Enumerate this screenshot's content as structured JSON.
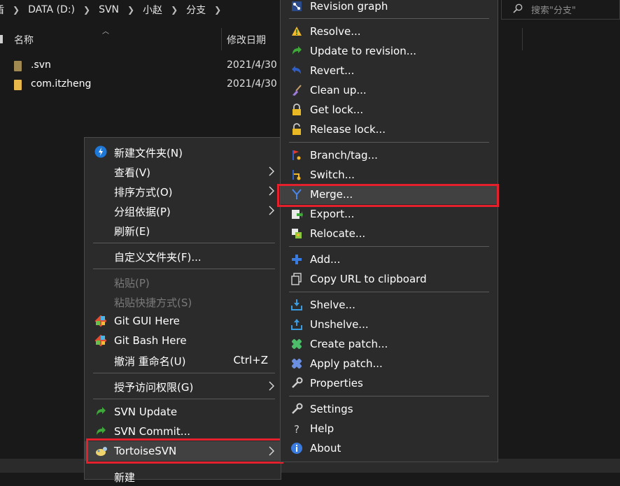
{
  "explorer": {
    "breadcrumb": [
      "盾",
      "DATA (D:)",
      "SVN",
      "小赵",
      "分支"
    ],
    "search_placeholder": "搜索\"分支\"",
    "columns": {
      "name": "名称",
      "date": "修改日期"
    },
    "files": [
      {
        "name": ".svn",
        "date": "2021/4/30"
      },
      {
        "name": "com.itzheng",
        "date": "2021/4/30"
      }
    ]
  },
  "context_menu": {
    "new_folder": "新建文件夹(N)",
    "view": "查看(V)",
    "sort_by": "排序方式(O)",
    "group_by": "分组依据(P)",
    "refresh": "刷新(E)",
    "customize_folder": "自定义文件夹(F)...",
    "paste": "粘贴(P)",
    "paste_shortcut": "粘贴快捷方式(S)",
    "git_gui": "Git GUI Here",
    "git_bash": "Git Bash Here",
    "undo_rename": "撤消 重命名(U)",
    "undo_shortcut": "Ctrl+Z",
    "give_access": "授予访问权限(G)",
    "svn_update": "SVN Update",
    "svn_commit": "SVN Commit...",
    "tortoise": "TortoiseSVN",
    "new": "新建"
  },
  "tortoise_menu": {
    "revision_graph": "Revision graph",
    "resolve": "Resolve...",
    "update_to_revision": "Update to revision...",
    "revert": "Revert...",
    "clean_up": "Clean up...",
    "get_lock": "Get lock...",
    "release_lock": "Release lock...",
    "branch_tag": "Branch/tag...",
    "switch": "Switch...",
    "merge": "Merge...",
    "export": "Export...",
    "relocate": "Relocate...",
    "add": "Add...",
    "copy_url": "Copy URL to clipboard",
    "shelve": "Shelve...",
    "unshelve": "Unshelve...",
    "create_patch": "Create patch...",
    "apply_patch": "Apply patch...",
    "properties": "Properties",
    "settings": "Settings",
    "help": "Help",
    "about": "About"
  },
  "colors": {
    "highlight": "#e3202c",
    "menu_bg": "#2b2b2b",
    "hover_bg": "#414141"
  }
}
